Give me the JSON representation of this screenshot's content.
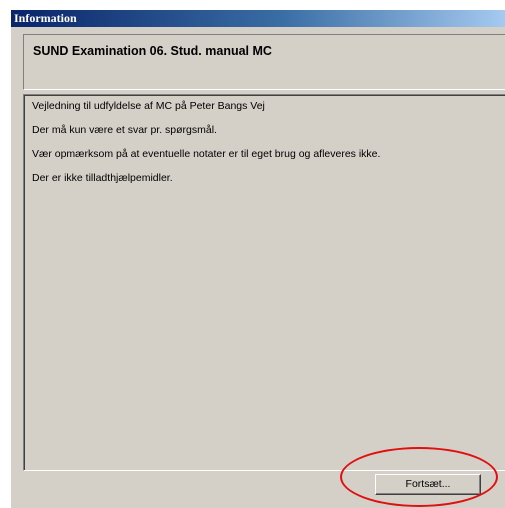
{
  "window": {
    "title": "Information"
  },
  "header": {
    "title": "SUND Examination 06. Stud. manual MC"
  },
  "body": {
    "lines": [
      "Vejledning til udfyldelse af MC på Peter Bangs Vej",
      "Der må kun være et svar pr. spørgsmål.",
      "Vær opmærksom på at eventuelle notater er til eget brug og afleveres ikke.",
      "Der er ikke tilladthjælpemidler."
    ]
  },
  "footer": {
    "continue_label": "Fortsæt..."
  },
  "colors": {
    "titlebar_start": "#0a246a",
    "titlebar_end": "#a6caf0",
    "window_bg": "#d4d0c8",
    "highlight": "#e01010"
  }
}
